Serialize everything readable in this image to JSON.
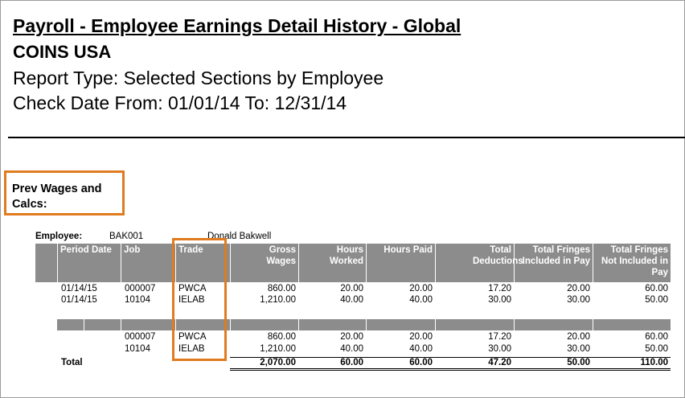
{
  "report": {
    "title": "Payroll - Employee Earnings Detail History - Global",
    "company": "COINS USA",
    "report_type": "Report Type: Selected Sections by Employee",
    "check_date": "Check Date From: 01/01/14 To: 12/31/14"
  },
  "section": {
    "title": "Prev Wages and Calcs:"
  },
  "employee": {
    "label": "Employee:",
    "id": "BAK001",
    "name": "Donald Bakwell"
  },
  "table": {
    "headers": {
      "period_date": "Period Date",
      "job": "Job",
      "trade": "Trade",
      "gross_wages": "Gross Wages",
      "hours_worked": "Hours Worked",
      "hours_paid": "Hours Paid",
      "total_deductions": "Total Deductions",
      "fringes_included": "Total Fringes Included in Pay",
      "fringes_not_included": "Total Fringes Not Included in Pay"
    },
    "rows": [
      {
        "period_date": "01/14/15",
        "job": "000007",
        "trade": "PWCA",
        "gross_wages": "860.00",
        "hours_worked": "20.00",
        "hours_paid": "20.00",
        "total_deductions": "17.20",
        "fringes_included": "20.00",
        "fringes_not_included": "60.00"
      },
      {
        "period_date": "01/14/15",
        "job": "10104",
        "trade": "IELAB",
        "gross_wages": "1,210.00",
        "hours_worked": "40.00",
        "hours_paid": "40.00",
        "total_deductions": "30.00",
        "fringes_included": "30.00",
        "fringes_not_included": "50.00"
      }
    ],
    "summary_rows": [
      {
        "job": "000007",
        "trade": "PWCA",
        "gross_wages": "860.00",
        "hours_worked": "20.00",
        "hours_paid": "20.00",
        "total_deductions": "17.20",
        "fringes_included": "20.00",
        "fringes_not_included": "60.00"
      },
      {
        "job": "10104",
        "trade": "IELAB",
        "gross_wages": "1,210.00",
        "hours_worked": "40.00",
        "hours_paid": "40.00",
        "total_deductions": "30.00",
        "fringes_included": "30.00",
        "fringes_not_included": "50.00"
      }
    ],
    "total": {
      "label": "Total",
      "gross_wages": "2,070.00",
      "hours_worked": "60.00",
      "hours_paid": "60.00",
      "total_deductions": "47.20",
      "fringes_included": "50.00",
      "fringes_not_included": "110.00"
    }
  },
  "colors": {
    "header_gray": "#8c8c8c",
    "highlight_orange": "#e07b1f"
  }
}
